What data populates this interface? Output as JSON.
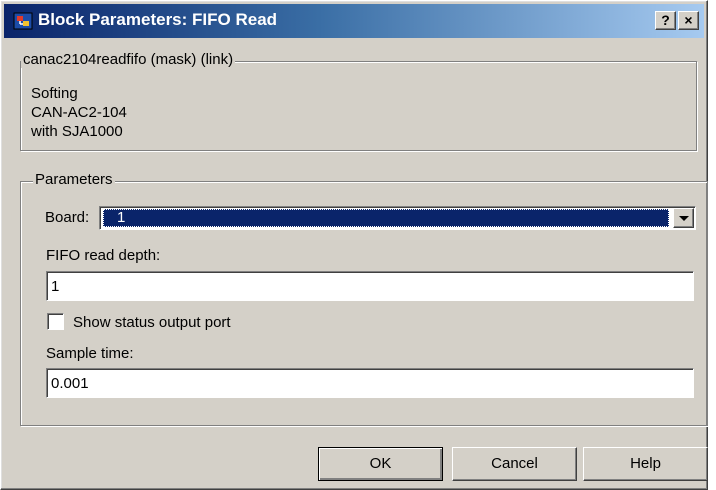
{
  "window": {
    "title": "Block Parameters: FIFO Read",
    "help_button": "?",
    "close_button": "×"
  },
  "mask_group": {
    "legend": "canac2104readfifo (mask) (link)",
    "description_lines": [
      "Softing",
      "CAN-AC2-104",
      "with SJA1000"
    ]
  },
  "parameters": {
    "legend": "Parameters",
    "board": {
      "label": "Board:",
      "value": "1"
    },
    "fifo_read_depth": {
      "label": "FIFO read depth:",
      "value": "1"
    },
    "show_status": {
      "label": "Show status output port",
      "checked": false
    },
    "sample_time": {
      "label": "Sample time:",
      "value": "0.001"
    }
  },
  "buttons": {
    "ok": {
      "mnemonic": "O",
      "rest": "K"
    },
    "cancel": {
      "mnemonic": "C",
      "rest": "ancel"
    },
    "help": {
      "mnemonic": "H",
      "rest": "elp"
    }
  },
  "colors": {
    "face": "#d4d0c8",
    "titlebar_start": "#0a246a",
    "titlebar_end": "#a6caf0",
    "selection": "#0a246a"
  },
  "icons": [
    "simulink-block-icon",
    "question-icon",
    "close-icon",
    "chevron-down-icon"
  ]
}
